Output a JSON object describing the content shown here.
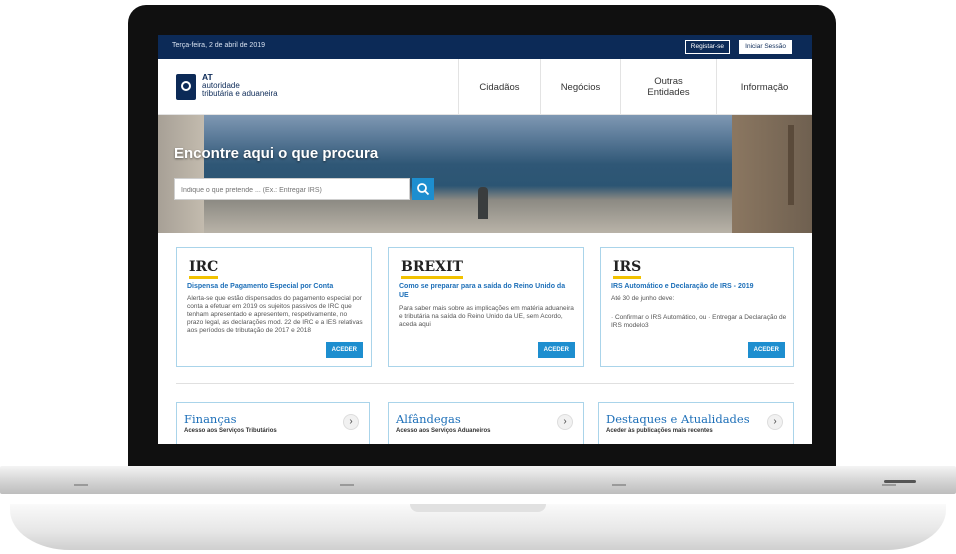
{
  "topbar": {
    "date": "Terça-feira, 2 de abril de 2019",
    "register_label": "Registar-se",
    "login_label": "Iniciar Sessão"
  },
  "logo": {
    "abbr": "AT",
    "line1": "autoridade",
    "line2": "tributária e aduaneira",
    "color": "#0c2a57"
  },
  "nav": {
    "items": [
      {
        "label": "Cidadãos"
      },
      {
        "label": "Negócios"
      },
      {
        "label_line1": "Outras",
        "label_line2": "Entidades"
      },
      {
        "label": "Informação"
      }
    ]
  },
  "hero": {
    "title": "Encontre aqui o que procura",
    "search_placeholder": "Indique o que pretende ... (Ex.: Entregar IRS)",
    "search_icon": "search-icon"
  },
  "cards": [
    {
      "title": "IRC",
      "subtitle": "Dispensa de Pagamento Especial por Conta",
      "body": "Alerta-se que estão dispensados do pagamento especial por conta a efetuar em 2019 os sujeitos passivos de IRC que tenham apresentado e apresentem, respetivamente, no prazo legal, as declarações mod. 22 de IRC e a IES relativas aos períodos de tributação de 2017 e 2018",
      "button": "ACEDER"
    },
    {
      "title": "BREXIT",
      "subtitle": "Como se preparar para a saída do Reino Unido da UE",
      "body": "Para saber mais sobre as implicações em matéria aduaneira e tributária na saída do Reino Unido da UE, sem Acordo, aceda aqui",
      "button": "ACEDER"
    },
    {
      "title": "IRS",
      "subtitle": "IRS Automático e Declaração de IRS - 2019",
      "body": "Até 30 de junho deve:",
      "body2": "· Confirmar o IRS Automático, ou · Entregar a Declaração de IRS modelo3",
      "button": "ACEDER"
    }
  ],
  "tiles": [
    {
      "title": "Finanças",
      "subtitle": "Acesso aos Serviços Tributários",
      "arrow": "›"
    },
    {
      "title": "Alfândegas",
      "subtitle": "Acesso aos Serviços Aduaneiros",
      "arrow": "›"
    },
    {
      "title": "Destaques e Atualidades",
      "subtitle": "Aceder às publicações mais recentes",
      "arrow": "›"
    }
  ],
  "colors": {
    "topbar": "#0c2a57",
    "accent": "#1d8ecf",
    "card_border": "#aad4ea",
    "title_underline": "#f2c200",
    "link": "#1d6fb8"
  }
}
